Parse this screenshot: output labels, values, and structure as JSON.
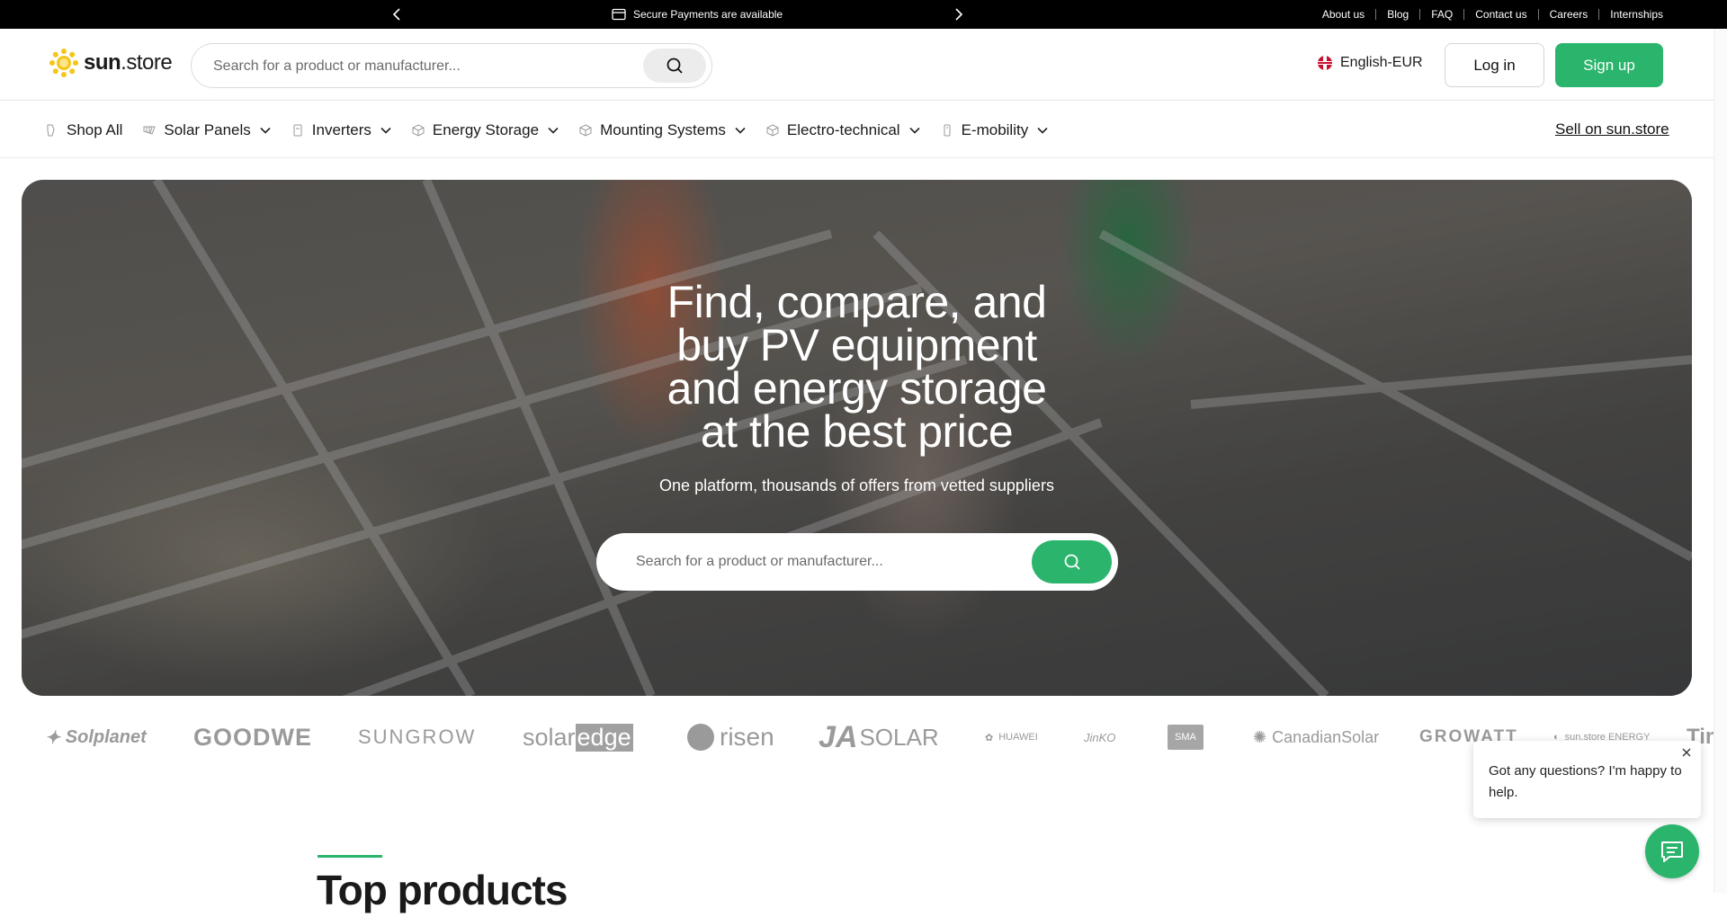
{
  "topbar": {
    "promo_text": "Secure Payments are available",
    "links": [
      "About us",
      "Blog",
      "FAQ",
      "Contact us",
      "Careers",
      "Internships"
    ]
  },
  "header": {
    "logo_bold": "sun",
    "logo_rest": ".store",
    "search_placeholder": "Search for a product or manufacturer...",
    "language": "English-EUR",
    "login_label": "Log in",
    "signup_label": "Sign up"
  },
  "nav": {
    "items": [
      {
        "label": "Shop All",
        "icon": "grid-icon"
      },
      {
        "label": "Solar Panels",
        "icon": "solar-panel-icon"
      },
      {
        "label": "Inverters",
        "icon": "inverter-icon"
      },
      {
        "label": "Energy Storage",
        "icon": "battery-icon"
      },
      {
        "label": "Mounting Systems",
        "icon": "mounting-icon"
      },
      {
        "label": "Electro-technical",
        "icon": "cable-icon"
      },
      {
        "label": "E-mobility",
        "icon": "charger-icon"
      }
    ],
    "sell_label": "Sell on sun.store"
  },
  "hero": {
    "title_lines": [
      "Find, compare, and",
      "buy PV equipment",
      "and energy storage",
      "at the best price"
    ],
    "subtitle": "One platform, thousands of offers from vetted suppliers",
    "search_placeholder": "Search for a product or manufacturer..."
  },
  "brands": [
    "Solplanet",
    "GOODWE",
    "SUNGROW",
    "solar",
    "edge",
    "risen",
    "JA",
    "SOLAR",
    "HUAWEI",
    "JinKO",
    "SMA",
    "CanadianSolar",
    "GROWATT",
    "sun.store ENERGY",
    "Tin"
  ],
  "section": {
    "title": "Top products"
  },
  "chat": {
    "message": "Got any questions? I'm happy to help."
  },
  "colors": {
    "accent": "#2bb46c",
    "topbar": "#000000"
  }
}
